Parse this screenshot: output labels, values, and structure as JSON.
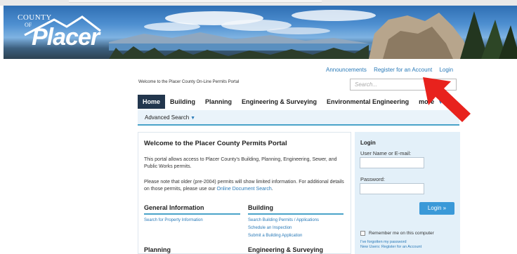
{
  "banner": {
    "logo_county": "COUNTY",
    "logo_of": "OF",
    "logo_name": "Placer"
  },
  "toplinks": [
    "Announcements",
    "Register for an Account",
    "Login"
  ],
  "welcome_text": "Welcome to the Placer County On-Line Permits Portal",
  "search": {
    "placeholder": "Search..."
  },
  "nav": {
    "items": [
      "Home",
      "Building",
      "Planning",
      "Engineering & Surveying",
      "Environmental Engineering",
      "more"
    ],
    "active": "Home"
  },
  "subnav": {
    "label": "Advanced Search"
  },
  "content": {
    "title": "Welcome to the Placer County Permits Portal",
    "para1": "This portal allows access to Placer County's Building, Planning, Engineering, Sewer, and Public Works permits.",
    "para2_text": "Please note that older (pre-2004) permits will show limited information. For additional details on those permits, please use our ",
    "para2_link": "Online Document Search",
    "para2_end": ".",
    "sections": {
      "general": {
        "title": "General Information",
        "links": [
          "Search for Property Information"
        ]
      },
      "building": {
        "title": "Building",
        "links": [
          "Search Building Permits / Applications",
          "Schedule an Inspection",
          "Submit a Building Application"
        ]
      },
      "planning": {
        "title": "Planning"
      },
      "engineering": {
        "title": "Engineering & Surveying"
      }
    }
  },
  "login": {
    "title": "Login",
    "username_label": "User Name or E-mail:",
    "password_label": "Password:",
    "button": "Login »",
    "remember": "Remember me on this computer",
    "forgot": "I've forgotten my password",
    "new_users": "New Users: Register for an Account"
  },
  "colors": {
    "accent": "#2a7ab8",
    "nav_active": "#22364d",
    "login_bg": "#e3f0f9",
    "login_button": "#3a99d8",
    "arrow": "#e8221d"
  }
}
